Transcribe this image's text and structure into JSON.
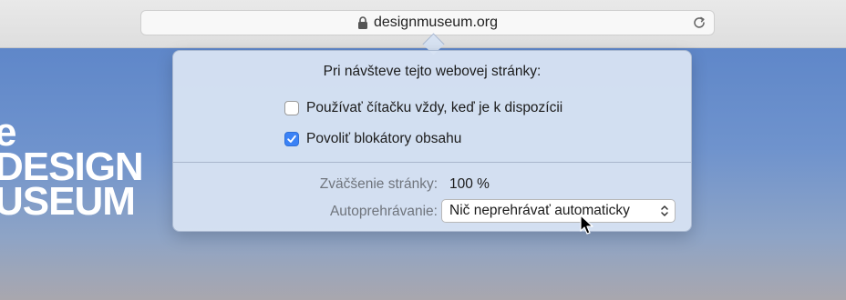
{
  "toolbar": {
    "url": "designmuseum.org",
    "lock_icon": "lock-icon",
    "reload_icon": "reload-icon"
  },
  "page": {
    "logo_lines": [
      "e",
      "DESIGN",
      "USEUM"
    ]
  },
  "popover": {
    "title": "Pri návšteve tejto webovej stránky:",
    "checkbox_reader": {
      "label": "Používať čítačku vždy, keď je k dispozícii",
      "checked": false
    },
    "checkbox_blockers": {
      "label": "Povoliť blokátory obsahu",
      "checked": true
    },
    "zoom_label": "Zväčšenie stránky:",
    "zoom_value": "100 %",
    "autoplay_label": "Autoprehrávanie:",
    "autoplay_value": "Nič neprehrávať automaticky"
  },
  "colors": {
    "checkbox_accent": "#3b82f6",
    "popover_bg": "#d6e2f3",
    "label_gray": "#6f747c"
  }
}
